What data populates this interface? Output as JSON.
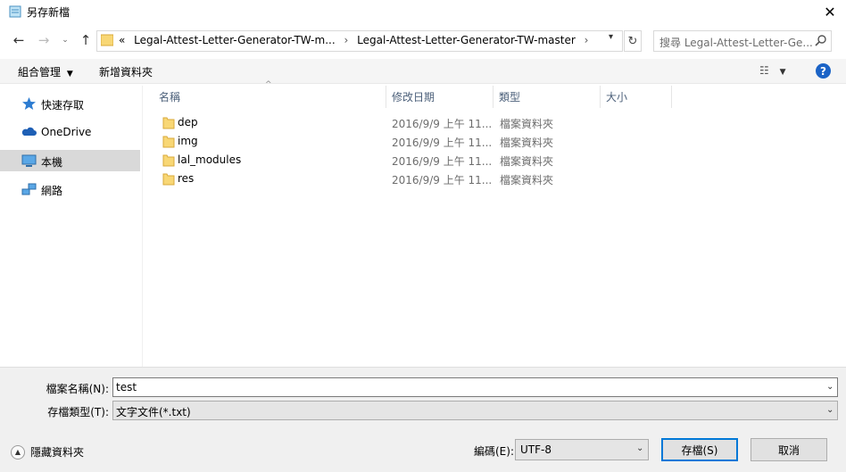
{
  "window": {
    "title": "另存新檔"
  },
  "nav": {
    "address_parts": [
      "«",
      "Legal-Attest-Letter-Generator-TW-m...",
      "›",
      "Legal-Attest-Letter-Generator-TW-master",
      "›"
    ],
    "search_placeholder": "搜尋 Legal-Attest-Letter-Ge..."
  },
  "toolbar": {
    "organize_label": "組合管理",
    "new_folder_label": "新增資料夾"
  },
  "sidebar": {
    "items": [
      {
        "label": "快速存取",
        "icon": "star-icon"
      },
      {
        "label": "OneDrive",
        "icon": "cloud-icon"
      },
      {
        "label": "本機",
        "icon": "computer-icon",
        "selected": true
      },
      {
        "label": "網路",
        "icon": "network-icon"
      }
    ]
  },
  "file_list": {
    "columns": [
      "名稱",
      "修改日期",
      "類型",
      "大小"
    ],
    "rows": [
      {
        "name": "dep",
        "date": "2016/9/9 上午 11...",
        "type": "檔案資料夾"
      },
      {
        "name": "img",
        "date": "2016/9/9 上午 11...",
        "type": "檔案資料夾"
      },
      {
        "name": "lal_modules",
        "date": "2016/9/9 上午 11...",
        "type": "檔案資料夾"
      },
      {
        "name": "res",
        "date": "2016/9/9 上午 11...",
        "type": "檔案資料夾"
      }
    ]
  },
  "form": {
    "filename_label": "檔案名稱(N):",
    "filename_value": "test",
    "filetype_label": "存檔類型(T):",
    "filetype_value": "文字文件(*.txt)",
    "hide_folders_label": "隱藏資料夾",
    "encoding_label": "編碼(E):",
    "encoding_value": "UTF-8",
    "save_label": "存檔(S)",
    "cancel_label": "取消"
  },
  "colors": {
    "accent": "#0078d7",
    "folder": "#f8d775",
    "help": "#1b63c6",
    "selected": "#d9d9d9"
  }
}
